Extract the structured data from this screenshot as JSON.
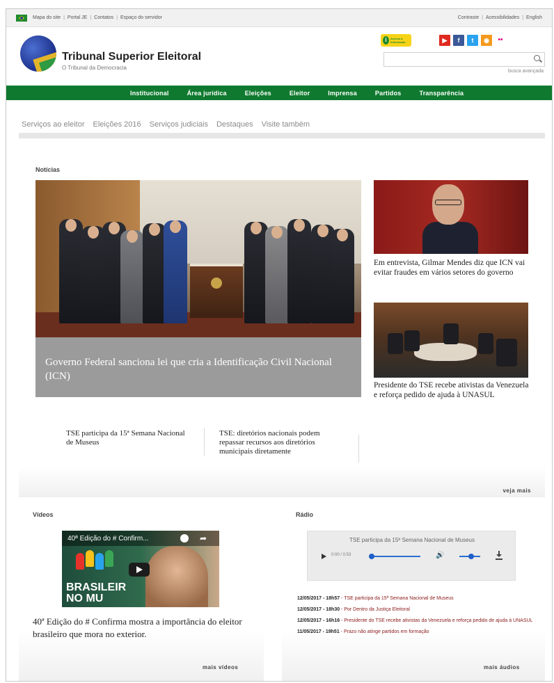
{
  "utility": {
    "left_links": [
      "Mapa do site",
      "Portal JE",
      "Contatos",
      "Espaço do servidor"
    ],
    "right_links": [
      "Contraste",
      "Acessibilidades",
      "English"
    ]
  },
  "header": {
    "title": "Tribunal Superior Eleitoral",
    "subtitle": "O Tribunal da Democracia",
    "acesso_label": "Acesso à Informação",
    "search_placeholder": "",
    "advanced_search": "busca avançada",
    "social_icons": [
      "youtube-icon",
      "facebook-icon",
      "twitter-icon",
      "rss-icon",
      "flickr-icon"
    ]
  },
  "nav": {
    "items": [
      "Institucional",
      "Área jurídica",
      "Eleições",
      "Eleitor",
      "Imprensa",
      "Partidos",
      "Transparência"
    ]
  },
  "subnav": {
    "items": [
      "Serviços ao eleitor",
      "Eleições 2016",
      "Serviços judiciais",
      "Destaques",
      "Visite também"
    ]
  },
  "news": {
    "section_title": "Notícias",
    "main_headline": "Governo Federal sanciona lei que cria a Identificação Civil Nacional (ICN)",
    "side": [
      "Em entrevista, Gilmar Mendes diz que ICN vai evitar fraudes em vários setores do governo",
      "Presidente do TSE recebe ativistas da Venezuela e reforça pedido de ajuda à UNASUL"
    ],
    "small": [
      "TSE participa da 15ª Semana Nacional de Museus",
      "TSE: diretórios nacionais podem repassar recursos aos diretórios municipais diretamente"
    ],
    "more": "veja mais"
  },
  "videos": {
    "section_title": "Vídeos",
    "thumb_title": "40ª Edição do # Confirm...",
    "thumb_overlay": "BRASILEIR\nNO MU",
    "title": "40ª Edição do # Confirma mostra a importância do eleitor brasileiro que mora no exterior.",
    "more": "mais vídeos"
  },
  "radio": {
    "section_title": "Rádio",
    "player_title": "TSE participa da 15ª Semana Nacional de Museus",
    "player_time": "0:00 / 0:53",
    "items": [
      {
        "date": "12/05/2017 - 18h57",
        "title": "TSE participa da 15ª Semana Nacional de Museus"
      },
      {
        "date": "12/05/2017 - 18h30",
        "title": "Por Dentro da Justiça Eleitoral"
      },
      {
        "date": "12/05/2017 - 16h16",
        "title": "Presidente do TSE recebe ativistas da Venezuela e reforça pedido de ajuda à UNASUL"
      },
      {
        "date": "11/05/2017 - 19h51",
        "title": "Prazo não atinge partidos em formação"
      }
    ],
    "more": "mais áudios"
  },
  "colors": {
    "nav_green": "#0f7a2f",
    "caption_gray": "#9b9b9b",
    "link_red": "#8b1a1a"
  }
}
